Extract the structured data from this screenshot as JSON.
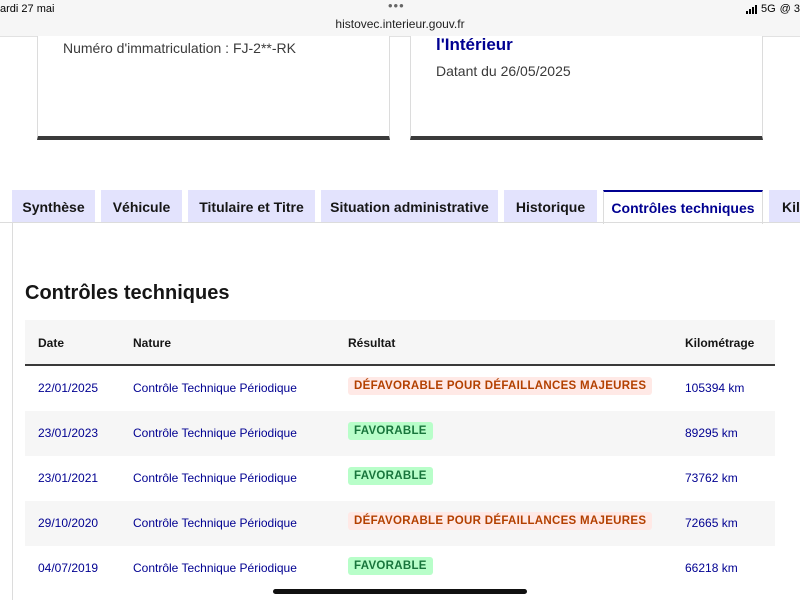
{
  "status_bar": {
    "date": "ardi 27 mai",
    "dots": "•••",
    "url": "histovec.interieur.gouv.fr",
    "network": "5G",
    "extra": "@ 3"
  },
  "cards": {
    "left": {
      "plate": "Numéro d'immatriculation : FJ-2**-RK"
    },
    "right": {
      "entity": "l'Intérieur",
      "dated": "Datant du 26/05/2025"
    }
  },
  "tabs": [
    {
      "label": "Synthèse"
    },
    {
      "label": "Véhicule"
    },
    {
      "label": "Titulaire et Titre"
    },
    {
      "label": "Situation administrative"
    },
    {
      "label": "Historique"
    },
    {
      "label": "Contrôles techniques",
      "active": true
    },
    {
      "label": "Kilo"
    }
  ],
  "section": {
    "title": "Contrôles techniques"
  },
  "table": {
    "headers": {
      "date": "Date",
      "nature": "Nature",
      "result": "Résultat",
      "km": "Kilométrage"
    },
    "rows": [
      {
        "date": "22/01/2025",
        "nature": "Contrôle Technique Périodique",
        "result": "DÉFAVORABLE POUR DÉFAILLANCES MAJEURES",
        "status": "bad",
        "km": "105394 km"
      },
      {
        "date": "23/01/2023",
        "nature": "Contrôle Technique Périodique",
        "result": "FAVORABLE",
        "status": "good",
        "km": "89295 km"
      },
      {
        "date": "23/01/2021",
        "nature": "Contrôle Technique Périodique",
        "result": "FAVORABLE",
        "status": "good",
        "km": "73762 km"
      },
      {
        "date": "29/10/2020",
        "nature": "Contrôle Technique Périodique",
        "result": "DÉFAVORABLE POUR DÉFAILLANCES MAJEURES",
        "status": "bad",
        "km": "72665 km"
      },
      {
        "date": "04/07/2019",
        "nature": "Contrôle Technique Périodique",
        "result": "FAVORABLE",
        "status": "good",
        "km": "66218 km"
      }
    ]
  },
  "colors": {
    "accent": "#000091",
    "tab_bg": "#e3e3fd",
    "bad_bg": "#ffe9e6",
    "bad_text": "#b34000",
    "good_bg": "#b8fec9",
    "good_text": "#18753c"
  }
}
